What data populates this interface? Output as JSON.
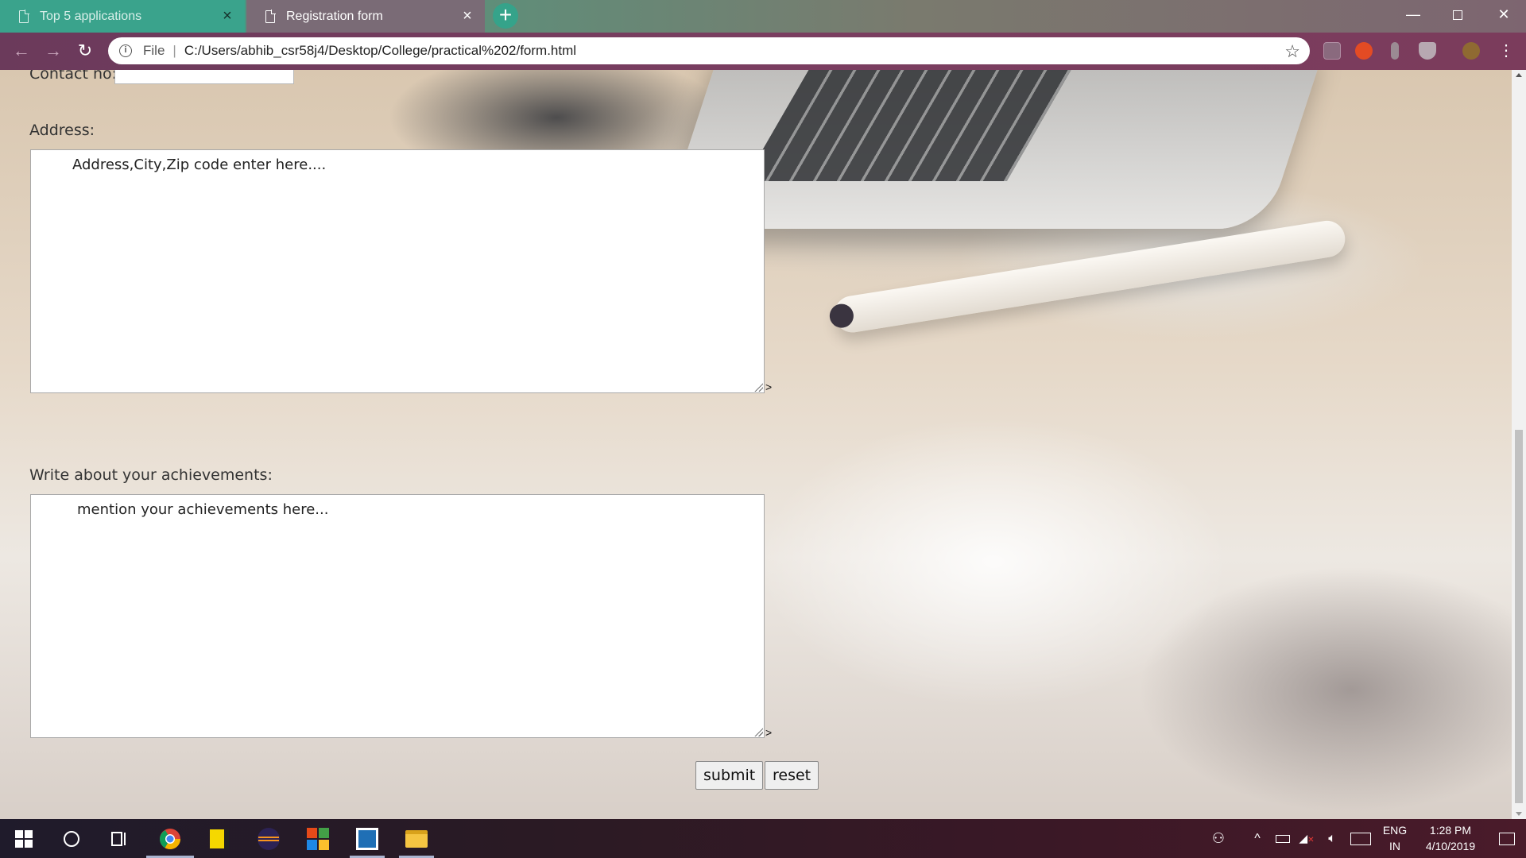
{
  "browser": {
    "tabs": [
      {
        "title": "Top 5 applications",
        "active": false
      },
      {
        "title": "Registration form",
        "active": true
      }
    ],
    "new_tab_icon": "plus-icon",
    "window_controls": [
      "minimize-icon",
      "restore-icon",
      "close-icon"
    ],
    "address": {
      "scheme_label": "File",
      "url": "C:/Users/abhib_csr58j4/Desktop/College/practical%202/form.html"
    },
    "toolbar_icons": [
      "back-icon",
      "forward-icon",
      "reload-icon",
      "info-icon",
      "star-icon",
      "pdf-extension-icon",
      "infinity-extension-icon",
      "figure-extension-icon",
      "shield-extension-icon",
      "profile-avatar-icon",
      "menu-dots-icon"
    ],
    "colors": {
      "active_tab": "#3aa38c",
      "toolbar": "#7a3e60"
    }
  },
  "form": {
    "contact_label": "Contact no:",
    "contact_value": "",
    "address_label": "Address:",
    "address_value": "Address,City,Zip code enter here....",
    "achievements_label": "Write about your achievements:",
    "achievements_value": "mention your achievements here...",
    "stray_char": ">",
    "submit_label": "submit",
    "reset_label": "reset"
  },
  "taskbar": {
    "apps": [
      "windows-start-icon",
      "cortana-search-icon",
      "task-view-icon",
      "chrome-icon",
      "sticky-notes-icon",
      "eclipse-icon",
      "office-icon",
      "bracket-app-icon",
      "file-explorer-icon"
    ],
    "tray": {
      "language_top": "ENG",
      "language_bottom": "IN",
      "time": "1:28 PM",
      "date": "4/10/2019"
    }
  }
}
